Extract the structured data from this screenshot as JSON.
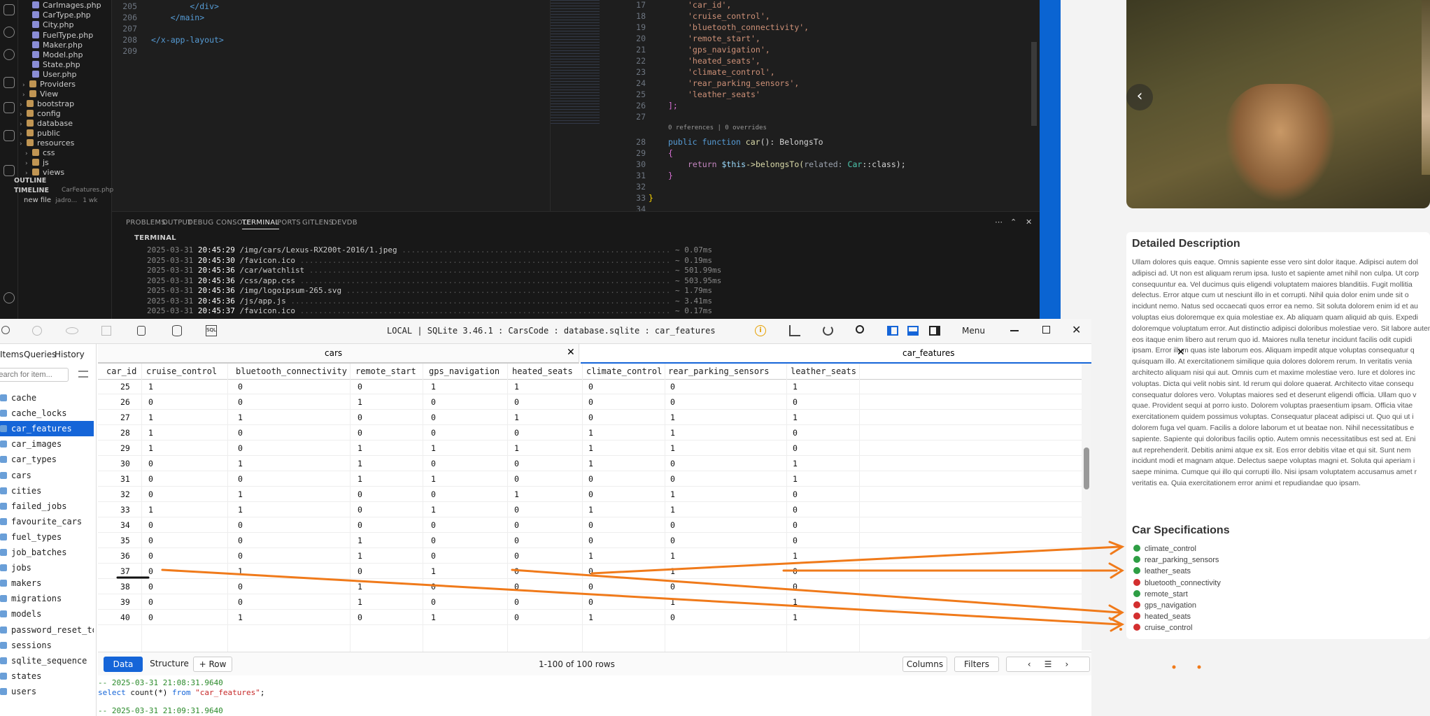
{
  "explorer": {
    "files": [
      "CarImages.php",
      "CarType.php",
      "City.php",
      "FuelType.php",
      "Maker.php",
      "Model.php",
      "State.php",
      "User.php"
    ],
    "folders": [
      "Providers",
      "View",
      "bootstrap",
      "config",
      "database",
      "public",
      "resources",
      "css",
      "js",
      "views"
    ],
    "outline": "OUTLINE",
    "timeline": "TIMELINE",
    "timeline_file": "CarFeatures.php",
    "timeline_entry": "new file",
    "timeline_author": "jadro...",
    "timeline_age": "1 wk"
  },
  "editor1": {
    "line_numbers": [
      "205",
      "206",
      "207",
      "208",
      "209"
    ],
    "lines": [
      "        </div>",
      "    </main>",
      "",
      "</x-app-layout>",
      ""
    ]
  },
  "editor2": {
    "line_numbers": [
      "17",
      "18",
      "19",
      "20",
      "21",
      "22",
      "23",
      "24",
      "25",
      "26",
      "27",
      "",
      "28",
      "29",
      "30",
      "31",
      "32",
      "33",
      "34"
    ],
    "features": [
      "'car_id',",
      "'cruise_control',",
      "'bluetooth_connectivity',",
      "'remote_start',",
      "'gps_navigation',",
      "'heated_seats',",
      "'climate_control',",
      "'rear_parking_sensors',",
      "'leather_seats'"
    ],
    "close_bracket": "];",
    "codelens": "0 references | 0 overrides",
    "fn_kw": "public function",
    "fn_name": "car",
    "fn_ret": "(): BelongsTo",
    "open_brace": "{",
    "return_kw": "return",
    "this_var": "$this",
    "belongs": "->belongsTo(",
    "hint": "related:",
    "car_cls": "Car",
    "class_end": "::class);",
    "close_brace": "}",
    "class_close": "}"
  },
  "panel": {
    "tabs": [
      "PROBLEMS",
      "OUTPUT",
      "DEBUG CONSOLE",
      "TERMINAL",
      "PORTS",
      "GITLENS",
      "DEVDB"
    ],
    "active_tab": "TERMINAL",
    "terminal_label": "TERMINAL",
    "log": [
      {
        "date": "2025-03-31",
        "time": "20:45:29",
        "path": "/img/cars/Lexus-RX200t-2016/1.jpeg",
        "ms": "~ 0.07ms"
      },
      {
        "date": "2025-03-31",
        "time": "20:45:30",
        "path": "/favicon.ico",
        "ms": "~ 0.19ms"
      },
      {
        "date": "2025-03-31",
        "time": "20:45:36",
        "path": "/car/watchlist",
        "ms": "~ 501.99ms"
      },
      {
        "date": "2025-03-31",
        "time": "20:45:36",
        "path": "/css/app.css",
        "ms": "~ 503.95ms"
      },
      {
        "date": "2025-03-31",
        "time": "20:45:36",
        "path": "/img/logoipsum-265.svg",
        "ms": "~ 1.79ms"
      },
      {
        "date": "2025-03-31",
        "time": "20:45:36",
        "path": "/js/app.js",
        "ms": "~ 3.41ms"
      },
      {
        "date": "2025-03-31",
        "time": "20:45:37",
        "path": "/favicon.ico",
        "ms": "~ 0.17ms"
      }
    ]
  },
  "browser": {
    "desc_title": "Detailed Description",
    "desc_lines": [
      "Ullam dolores quis eaque. Omnis sapiente esse vero sint dolor itaque. Adipisci autem dol",
      "adipisci ad. Ut non est aliquam rerum ipsa. Iusto et sapiente amet nihil non culpa. Ut corp",
      "consequuntur ea. Vel ducimus quis eligendi voluptatem maiores blanditiis. Fugit mollitia",
      "delectus. Error atque cum ut nesciunt illo in et corrupti. Nihil quia dolor enim unde sit o",
      "incidunt nemo. Natus sed occaecati quos error ea nemo. Sit soluta dolorem enim id et au",
      "voluptas eius doloremque ex quia molestiae ex. Ab aliquam quam aliquid ab quis. Expedi",
      "doloremque voluptatum error. Aut distinctio adipisci doloribus molestiae vero. Sit labore autem",
      "eos itaque enim libero aut rerum quo id. Maiores nulla tenetur incidunt facilis odit cupidi",
      "ipsam. Error illum quas iste laborum eos. Aliquam impedit atque voluptas consequatur q",
      "quisquam illo. At exercitationem similique quia dolores dolorem rerum. In veritatis venia",
      "architecto aliquam nisi qui aut. Omnis cum et maxime molestiae vero. Iure et dolores inc",
      "voluptas. Dicta qui velit nobis sint. Id rerum qui dolore quaerat. Architecto vitae consequ",
      "consequatur dolores vero. Voluptas maiores sed et deserunt eligendi officia. Ullam quo v",
      "quae. Provident sequi at porro iusto. Dolorem voluptas praesentium ipsam. Officia vitae",
      "exercitationem quidem possimus voluptas. Consequatur placeat adipisci ut. Quo qui ut i",
      "dolorem fuga vel quam. Facilis a dolore laborum et ut beatae non. Nihil necessitatibus e",
      "sapiente. Sapiente qui doloribus facilis optio. Autem omnis necessitatibus est sed at. Eni",
      "aut reprehenderit. Debitis animi atque ex sit. Eos error debitis vitae et qui sit. Sunt nem",
      "incidunt modi et magnam atque. Delectus saepe voluptas magni et. Soluta qui aperiam i",
      "saepe minima. Cumque qui illo qui corrupti illo. Nisi ipsam voluptatem accusamus amet r",
      "veritatis ea. Quia exercitationem error animi et repudiandae quo ipsam."
    ],
    "spec_title": "Car Specifications",
    "specs": [
      {
        "name": "climate_control",
        "on": true
      },
      {
        "name": "rear_parking_sensors",
        "on": true
      },
      {
        "name": "leather_seats",
        "on": true
      },
      {
        "name": "bluetooth_connectivity",
        "on": false
      },
      {
        "name": "remote_start",
        "on": true
      },
      {
        "name": "gps_navigation",
        "on": false
      },
      {
        "name": "heated_seats",
        "on": false
      },
      {
        "name": "cruise_control",
        "on": false
      }
    ],
    "colors": {
      "on": "#2e9e44",
      "off": "#d32f2f",
      "annot": "#f07a1a"
    }
  },
  "db": {
    "title": "LOCAL | SQLite 3.46.1 : CarsCode : database.sqlite : car_features",
    "menu": "Menu",
    "side_tabs": [
      "Items",
      "Queries",
      "History"
    ],
    "search_placeholder": "Search for item...",
    "tables": [
      "cache",
      "cache_locks",
      "car_features",
      "car_images",
      "car_types",
      "cars",
      "cities",
      "failed_jobs",
      "favourite_cars",
      "fuel_types",
      "job_batches",
      "jobs",
      "makers",
      "migrations",
      "models",
      "password_reset_to",
      "sessions",
      "sqlite_sequence",
      "states",
      "users"
    ],
    "selected_table": "car_features",
    "tabs": [
      "cars",
      "car_features"
    ],
    "columns": [
      "car_id",
      "cruise_control",
      "bluetooth_connectivity",
      "remote_start",
      "gps_navigation",
      "heated_seats",
      "climate_control",
      "rear_parking_sensors",
      "leather_seats"
    ],
    "rows": [
      [
        "25",
        "1",
        "0",
        "0",
        "1",
        "1",
        "0",
        "0",
        "1"
      ],
      [
        "26",
        "0",
        "0",
        "1",
        "0",
        "0",
        "0",
        "0",
        "0"
      ],
      [
        "27",
        "1",
        "1",
        "0",
        "0",
        "1",
        "0",
        "1",
        "1"
      ],
      [
        "28",
        "1",
        "0",
        "0",
        "0",
        "0",
        "1",
        "1",
        "0"
      ],
      [
        "29",
        "1",
        "0",
        "1",
        "1",
        "1",
        "1",
        "1",
        "0"
      ],
      [
        "30",
        "0",
        "1",
        "1",
        "0",
        "0",
        "1",
        "0",
        "1"
      ],
      [
        "31",
        "0",
        "0",
        "1",
        "1",
        "0",
        "0",
        "0",
        "1"
      ],
      [
        "32",
        "0",
        "1",
        "0",
        "0",
        "1",
        "0",
        "1",
        "0"
      ],
      [
        "33",
        "1",
        "1",
        "0",
        "1",
        "0",
        "1",
        "1",
        "0"
      ],
      [
        "34",
        "0",
        "0",
        "0",
        "0",
        "0",
        "0",
        "0",
        "0"
      ],
      [
        "35",
        "0",
        "0",
        "1",
        "0",
        "0",
        "0",
        "0",
        "0"
      ],
      [
        "36",
        "0",
        "0",
        "1",
        "0",
        "0",
        "1",
        "1",
        "1"
      ],
      [
        "37",
        "0",
        "1",
        "0",
        "1",
        "0",
        "0",
        "1",
        "0"
      ],
      [
        "38",
        "0",
        "0",
        "1",
        "0",
        "0",
        "0",
        "0",
        "0"
      ],
      [
        "39",
        "0",
        "0",
        "1",
        "0",
        "0",
        "0",
        "1",
        "1"
      ],
      [
        "40",
        "0",
        "1",
        "0",
        "1",
        "0",
        "1",
        "0",
        "1"
      ]
    ],
    "bottom": {
      "data": "Data",
      "structure": "Structure",
      "row": "+ Row",
      "rows_info": "1-100 of 100 rows",
      "columns": "Columns",
      "filters": "Filters"
    },
    "sql": {
      "comment": "-- 2025-03-31 21:08:31.9640",
      "kw1": "select",
      "fn": "count",
      "args": "(*)",
      "kw2": "from",
      "table": "\"car_features\"",
      "end": ";",
      "comment2": "-- 2025-03-31 21:09:31.9640"
    }
  }
}
